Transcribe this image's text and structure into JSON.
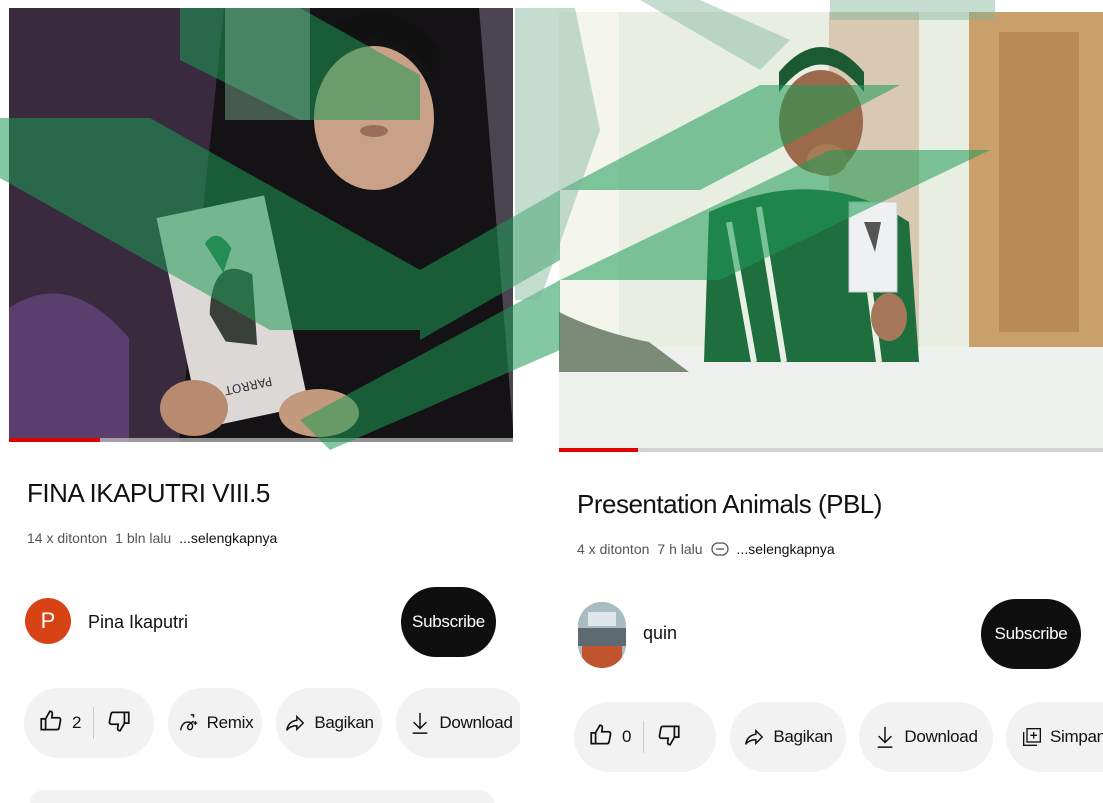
{
  "left_video": {
    "title": "FINA IKAPUTRI VIII.5",
    "views": "14 x ditonton",
    "age": "1 bln lalu",
    "more": "...selengkapnya",
    "channel_name": "Pina Ikaputri",
    "avatar_letter": "P",
    "subscribe_label": "Subscribe",
    "likes": "2",
    "remix_label": "Remix",
    "share_label": "Bagikan",
    "download_label": "Download",
    "progress": 0.18,
    "card_text": "PARROT"
  },
  "right_video": {
    "title": "Presentation Animals (PBL)",
    "views": "4 x ditonton",
    "age": "7 h lalu",
    "more": "...selengkapnya",
    "channel_name": "quin",
    "subscribe_label": "Subscribe",
    "likes": "0",
    "share_label": "Bagikan",
    "download_label": "Download",
    "save_label": "Simpan",
    "progress": 0.145
  },
  "colors": {
    "accent_red": "#e00000",
    "avatar_orange": "#d84315",
    "watermark_green": "#1e9a55"
  },
  "icons": [
    "like-icon",
    "dislike-icon",
    "remix-icon",
    "share-icon",
    "download-icon",
    "save-icon",
    "link-icon"
  ]
}
